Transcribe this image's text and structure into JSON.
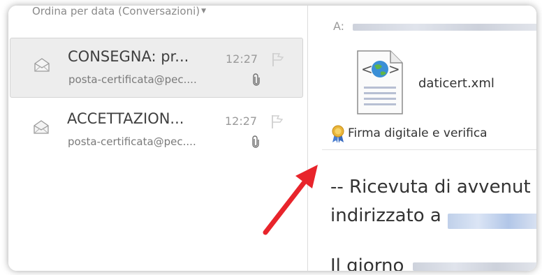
{
  "message_list": {
    "sort_label": "Ordina per data (Conversazioni)",
    "messages": [
      {
        "subject": "CONSEGNA: pr...",
        "time": "12:27",
        "sender": "posta-certificata@pec....",
        "selected": true,
        "icon": "opened-envelope-icon"
      },
      {
        "subject": "ACCETTAZION...",
        "time": "12:27",
        "sender": "posta-certificata@pec....",
        "selected": false,
        "icon": "opened-envelope-icon"
      }
    ]
  },
  "reading_pane": {
    "to_label": "A:",
    "attachment": {
      "file_name": "daticert.xml",
      "icon": "xml-document-icon"
    },
    "signature_label": "Firma digitale e verifica",
    "body_lines": [
      "-- Ricevuta di avvenut",
      "indirizzato a",
      "Il giorno"
    ]
  },
  "annotation": {
    "color": "#e8242b"
  }
}
